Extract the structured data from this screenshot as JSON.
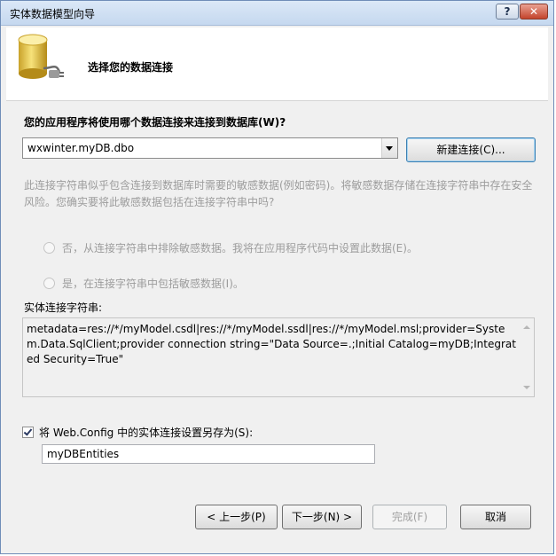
{
  "window": {
    "title": "实体数据模型向导",
    "help_label": "?",
    "close_label": "✕"
  },
  "header": {
    "title": "选择您的数据连接"
  },
  "connection": {
    "question": "您的应用程序将使用哪个数据连接来连接到数据库(W)?",
    "selected": "wxwinter.myDB.dbo",
    "new_button": "新建连接(C)..."
  },
  "sensitive": {
    "warning": "此连接字符串似乎包含连接到数据库时需要的敏感数据(例如密码)。将敏感数据存储在连接字符串中存在安全风险。您确实要将此敏感数据包括在连接字符串中吗?",
    "option_exclude": "否，从连接字符串中排除敏感数据。我将在应用程序代码中设置此数据(E)。",
    "option_include": "是，在连接字符串中包括敏感数据(I)。"
  },
  "entity_string": {
    "label": "实体连接字符串:",
    "value": "metadata=res://*/myModel.csdl|res://*/myModel.ssdl|res://*/myModel.msl;provider=System.Data.SqlClient;provider connection string=\"Data Source=.;Initial Catalog=myDB;Integrated Security=True\""
  },
  "save_settings": {
    "checked": true,
    "label": "将 Web.Config 中的实体连接设置另存为(S):",
    "value": "myDBEntities"
  },
  "footer": {
    "prev": "< 上一步(P)",
    "next": "下一步(N) >",
    "finish": "完成(F)",
    "cancel": "取消"
  }
}
